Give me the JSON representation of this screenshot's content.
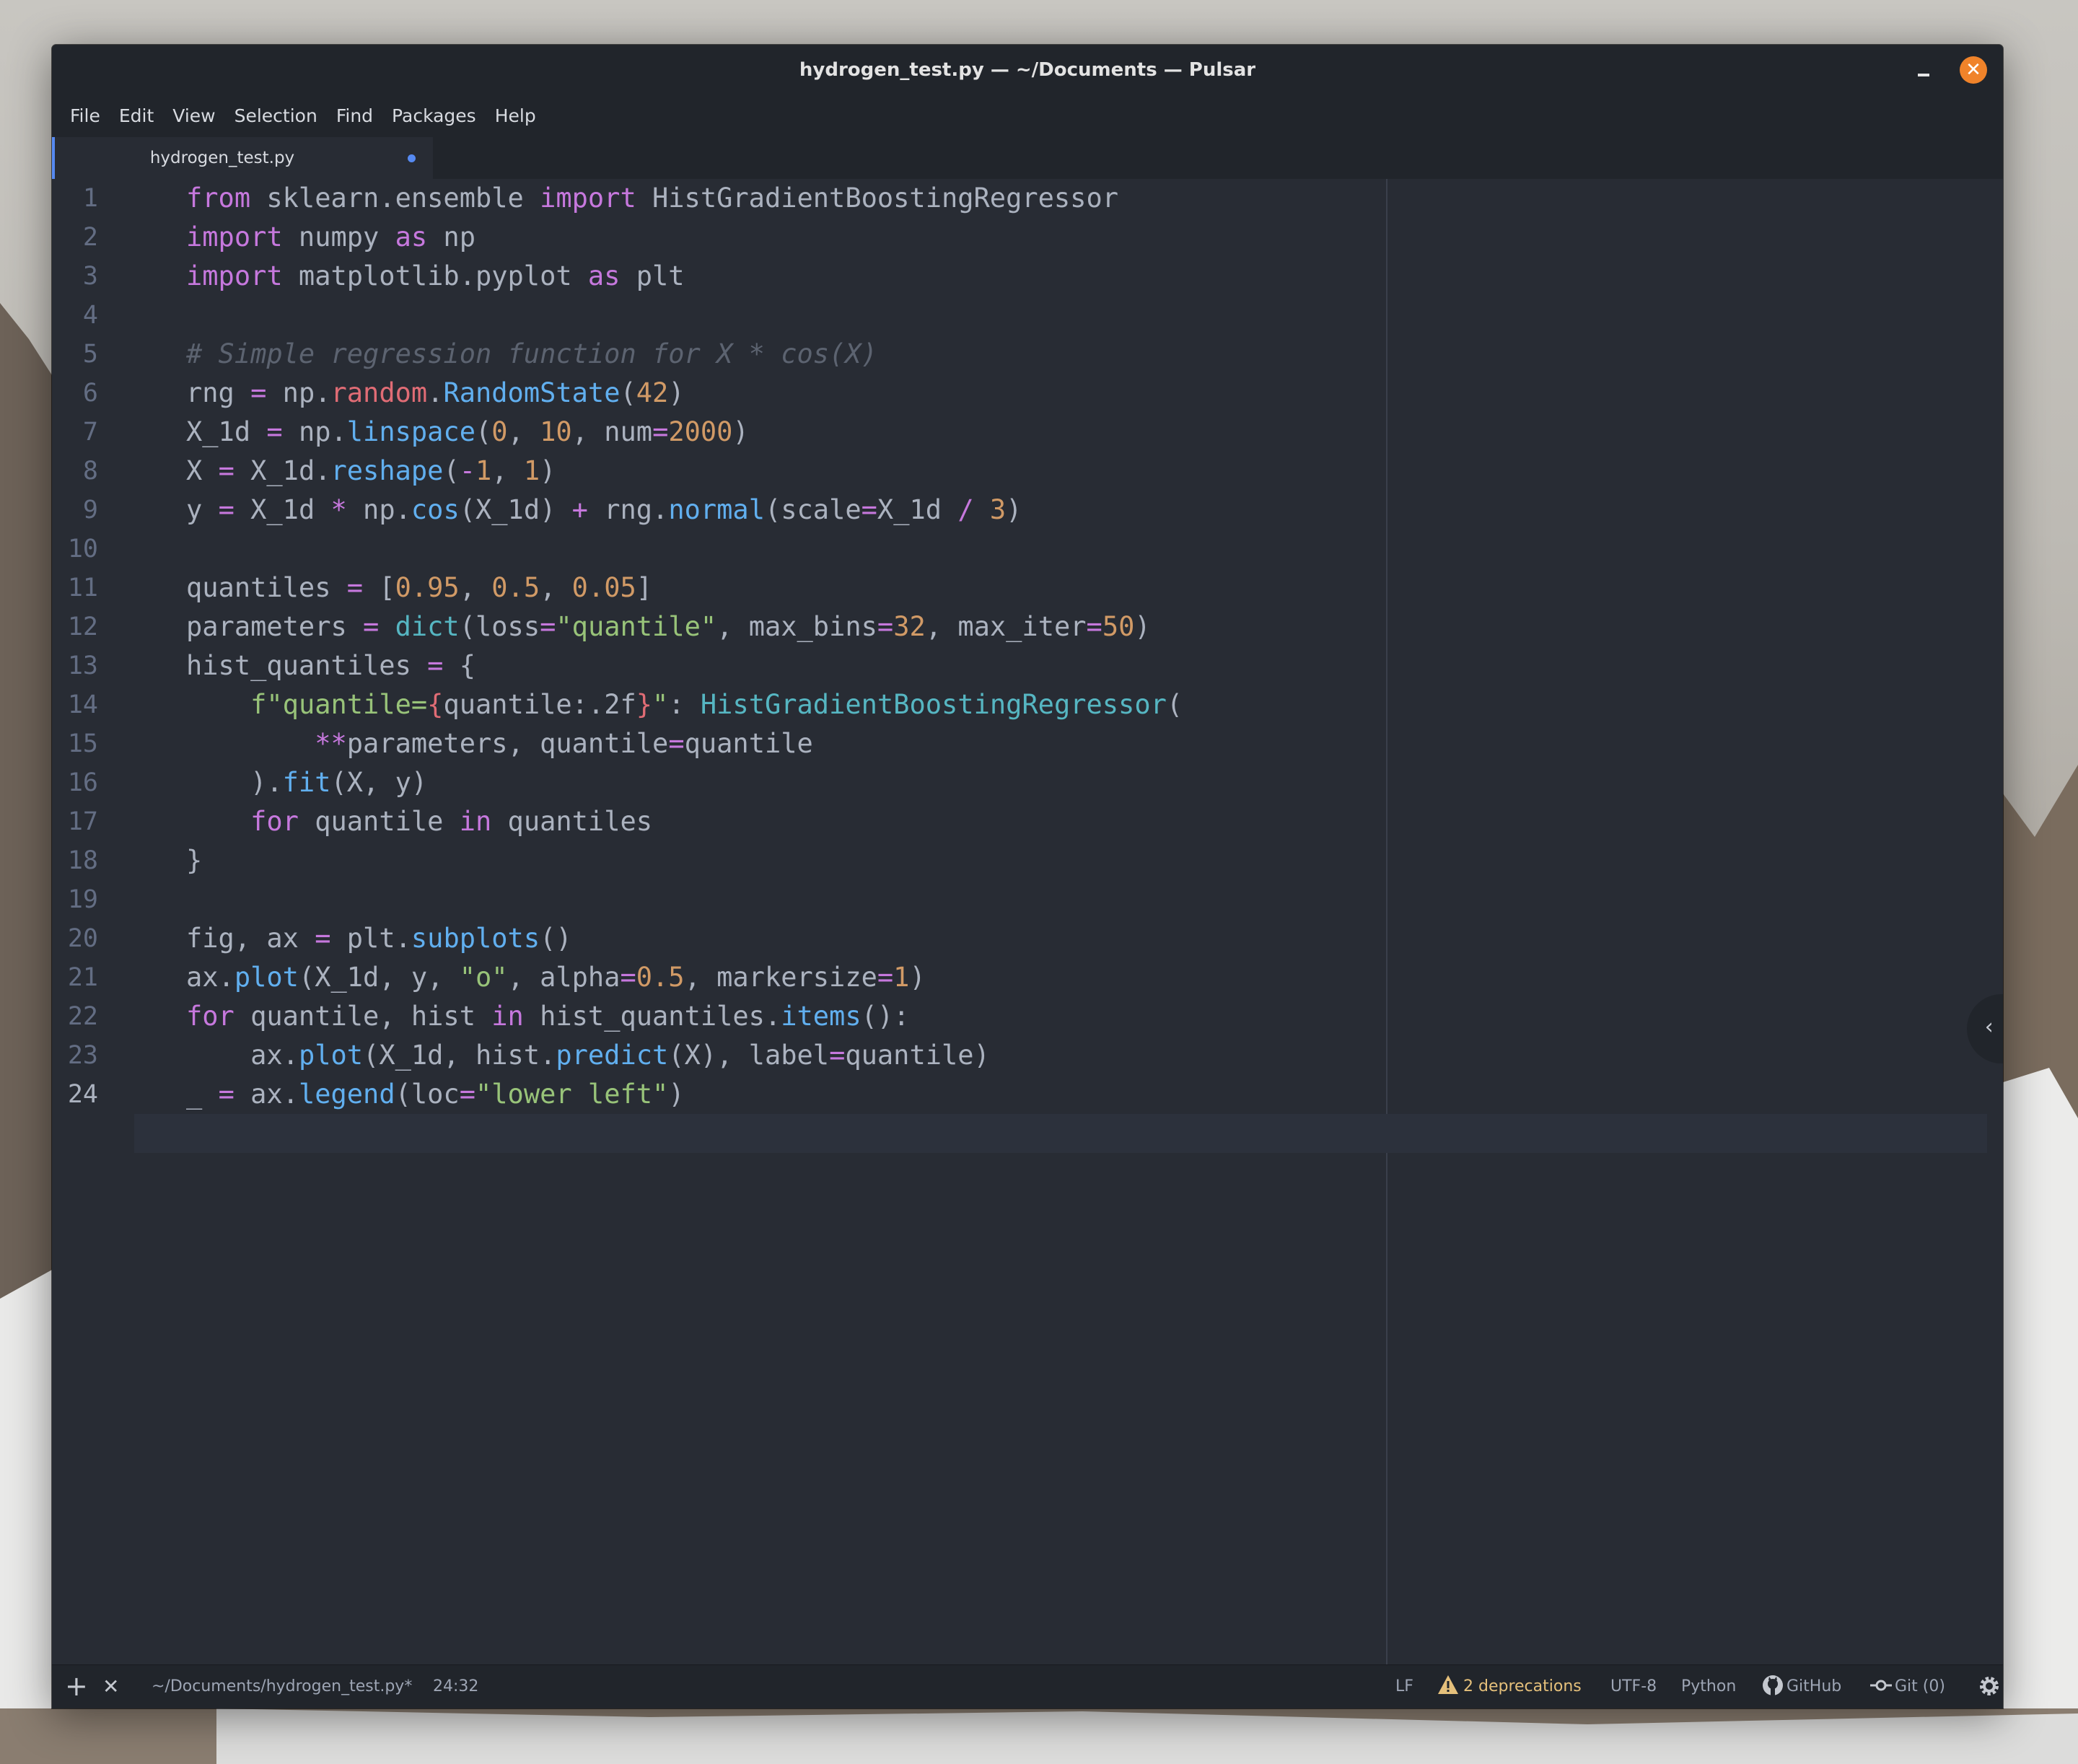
{
  "window": {
    "title": "hydrogen_test.py — ~/Documents — Pulsar",
    "minimize_icon": "minimize-icon",
    "close_icon": "close-icon",
    "close_glyph": "✕"
  },
  "menu": [
    "File",
    "Edit",
    "View",
    "Selection",
    "Find",
    "Packages",
    "Help"
  ],
  "tab": {
    "title": "hydrogen_test.py",
    "modified": true
  },
  "editor": {
    "language": "Python",
    "active_line": 24,
    "line_numbers": [
      "1",
      "2",
      "3",
      "4",
      "5",
      "6",
      "7",
      "8",
      "9",
      "10",
      "11",
      "12",
      "13",
      "14",
      "15",
      "16",
      "17",
      "18",
      "19",
      "20",
      "21",
      "22",
      "23",
      "24"
    ],
    "lines": [
      "from sklearn.ensemble import HistGradientBoostingRegressor",
      "import numpy as np",
      "import matplotlib.pyplot as plt",
      "",
      "# Simple regression function for X * cos(X)",
      "rng = np.random.RandomState(42)",
      "X_1d = np.linspace(0, 10, num=2000)",
      "X = X_1d.reshape(-1, 1)",
      "y = X_1d * np.cos(X_1d) + rng.normal(scale=X_1d / 3)",
      "",
      "quantiles = [0.95, 0.5, 0.05]",
      "parameters = dict(loss=\"quantile\", max_bins=32, max_iter=50)",
      "hist_quantiles = {",
      "    f\"quantile={quantile:.2f}\": HistGradientBoostingRegressor(",
      "        **parameters, quantile=quantile",
      "    ).fit(X, y)",
      "    for quantile in quantiles",
      "}",
      "",
      "fig, ax = plt.subplots()",
      "ax.plot(X_1d, y, \"o\", alpha=0.5, markersize=1)",
      "for quantile, hist in hist_quantiles.items():",
      "    ax.plot(X_1d, hist.predict(X), label=quantile)",
      "_ = ax.legend(loc=\"lower left\")"
    ]
  },
  "status_bar": {
    "add_icon": "plus-icon",
    "add_glyph": "+",
    "close_icon": "close-icon",
    "close_glyph": "✕",
    "file_path": "~/Documents/hydrogen_test.py*",
    "cursor_position": "24:32",
    "line_ending": "LF",
    "warning_icon": "warning-icon",
    "deprecations": "2 deprecations",
    "encoding": "UTF-8",
    "grammar": "Python",
    "github_icon": "github-icon",
    "github_label": "GitHub",
    "git_icon": "git-commit-icon",
    "git_label": "Git (0)",
    "settings_icon": "gear-icon",
    "colors": {
      "accent": "#568af2",
      "warning": "#e5c07b",
      "close_button": "#f0832a"
    }
  },
  "dock_toggle_icon": "chevron-left-icon"
}
